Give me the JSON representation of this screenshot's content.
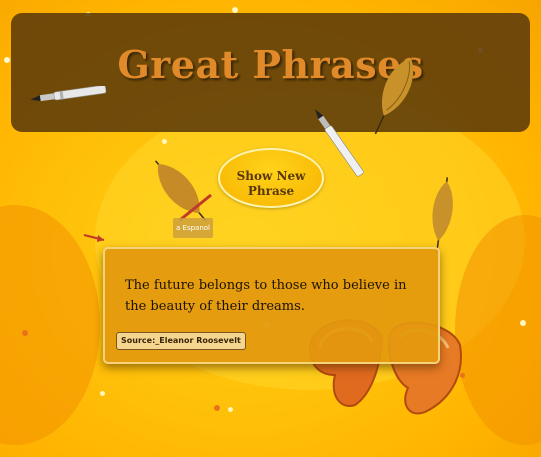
{
  "header": {
    "title": "Great Phrases"
  },
  "actions": {
    "show_new_phrase_line1": "Show New",
    "show_new_phrase_line2": "Phrase",
    "language_label": "a Espanol"
  },
  "quote": {
    "text": "The future belongs to those who believe in the beauty of their dreams.",
    "source_label": "Source:_Eleanor Roosevelt"
  },
  "colors": {
    "background": "#ffc20a",
    "header_bg": "#5c3a0a",
    "title": "#e08a2a",
    "quote_bg": "#e3990e",
    "button_bg": "#f7b400"
  },
  "icons": [
    "feather-icon",
    "pen-icon",
    "fortune-cookie-icon"
  ]
}
